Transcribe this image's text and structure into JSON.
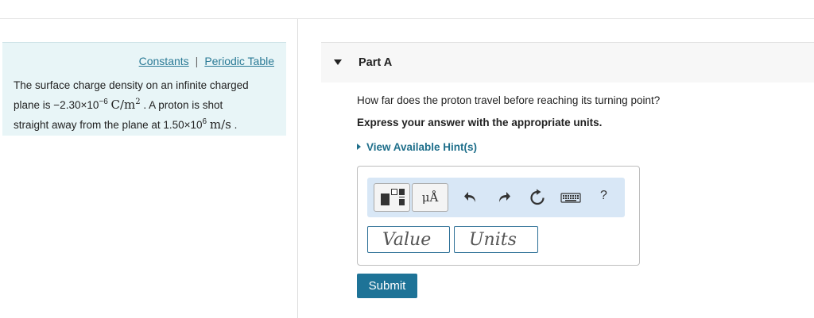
{
  "left_panel": {
    "links": {
      "constants": "Constants",
      "separator": "|",
      "periodic_table": "Periodic Table"
    },
    "problem": {
      "line1": "The surface charge density on an infinite charged",
      "line2_prefix": "plane is ",
      "density_value": "−2.30×10",
      "density_exp": "−6",
      "density_unit_base": "C/m",
      "density_unit_exp": "2",
      "line2_suffix": " . A proton is shot",
      "line3_prefix": "straight away from the plane at ",
      "speed_value": "1.50×10",
      "speed_exp": "6",
      "speed_unit": "m/s",
      "line3_suffix": " ."
    }
  },
  "part": {
    "title": "Part A"
  },
  "question": "How far does the proton travel before reaching its turning point?",
  "instruction": "Express your answer with the appropriate units.",
  "hint_link": "View Available Hint(s)",
  "toolbar": {
    "units_label": "μÅ",
    "help_label": "?"
  },
  "inputs": {
    "value_placeholder": "Value",
    "units_placeholder": "Units"
  },
  "submit_label": "Submit"
}
